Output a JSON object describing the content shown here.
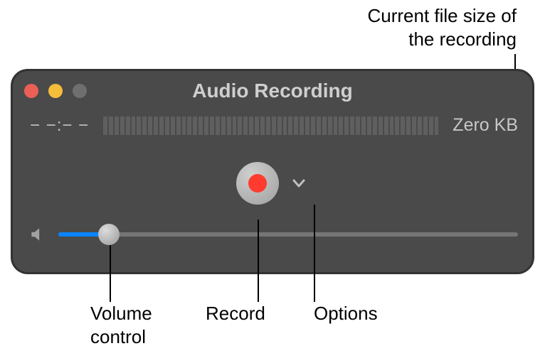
{
  "callouts": {
    "filesize": "Current file size of\nthe recording",
    "volume": "Volume\ncontrol",
    "record": "Record",
    "options": "Options"
  },
  "window": {
    "title": "Audio Recording",
    "time": "− −:− −",
    "filesize": "Zero KB",
    "level_meter_bars": 60,
    "volume_percent": 11
  }
}
